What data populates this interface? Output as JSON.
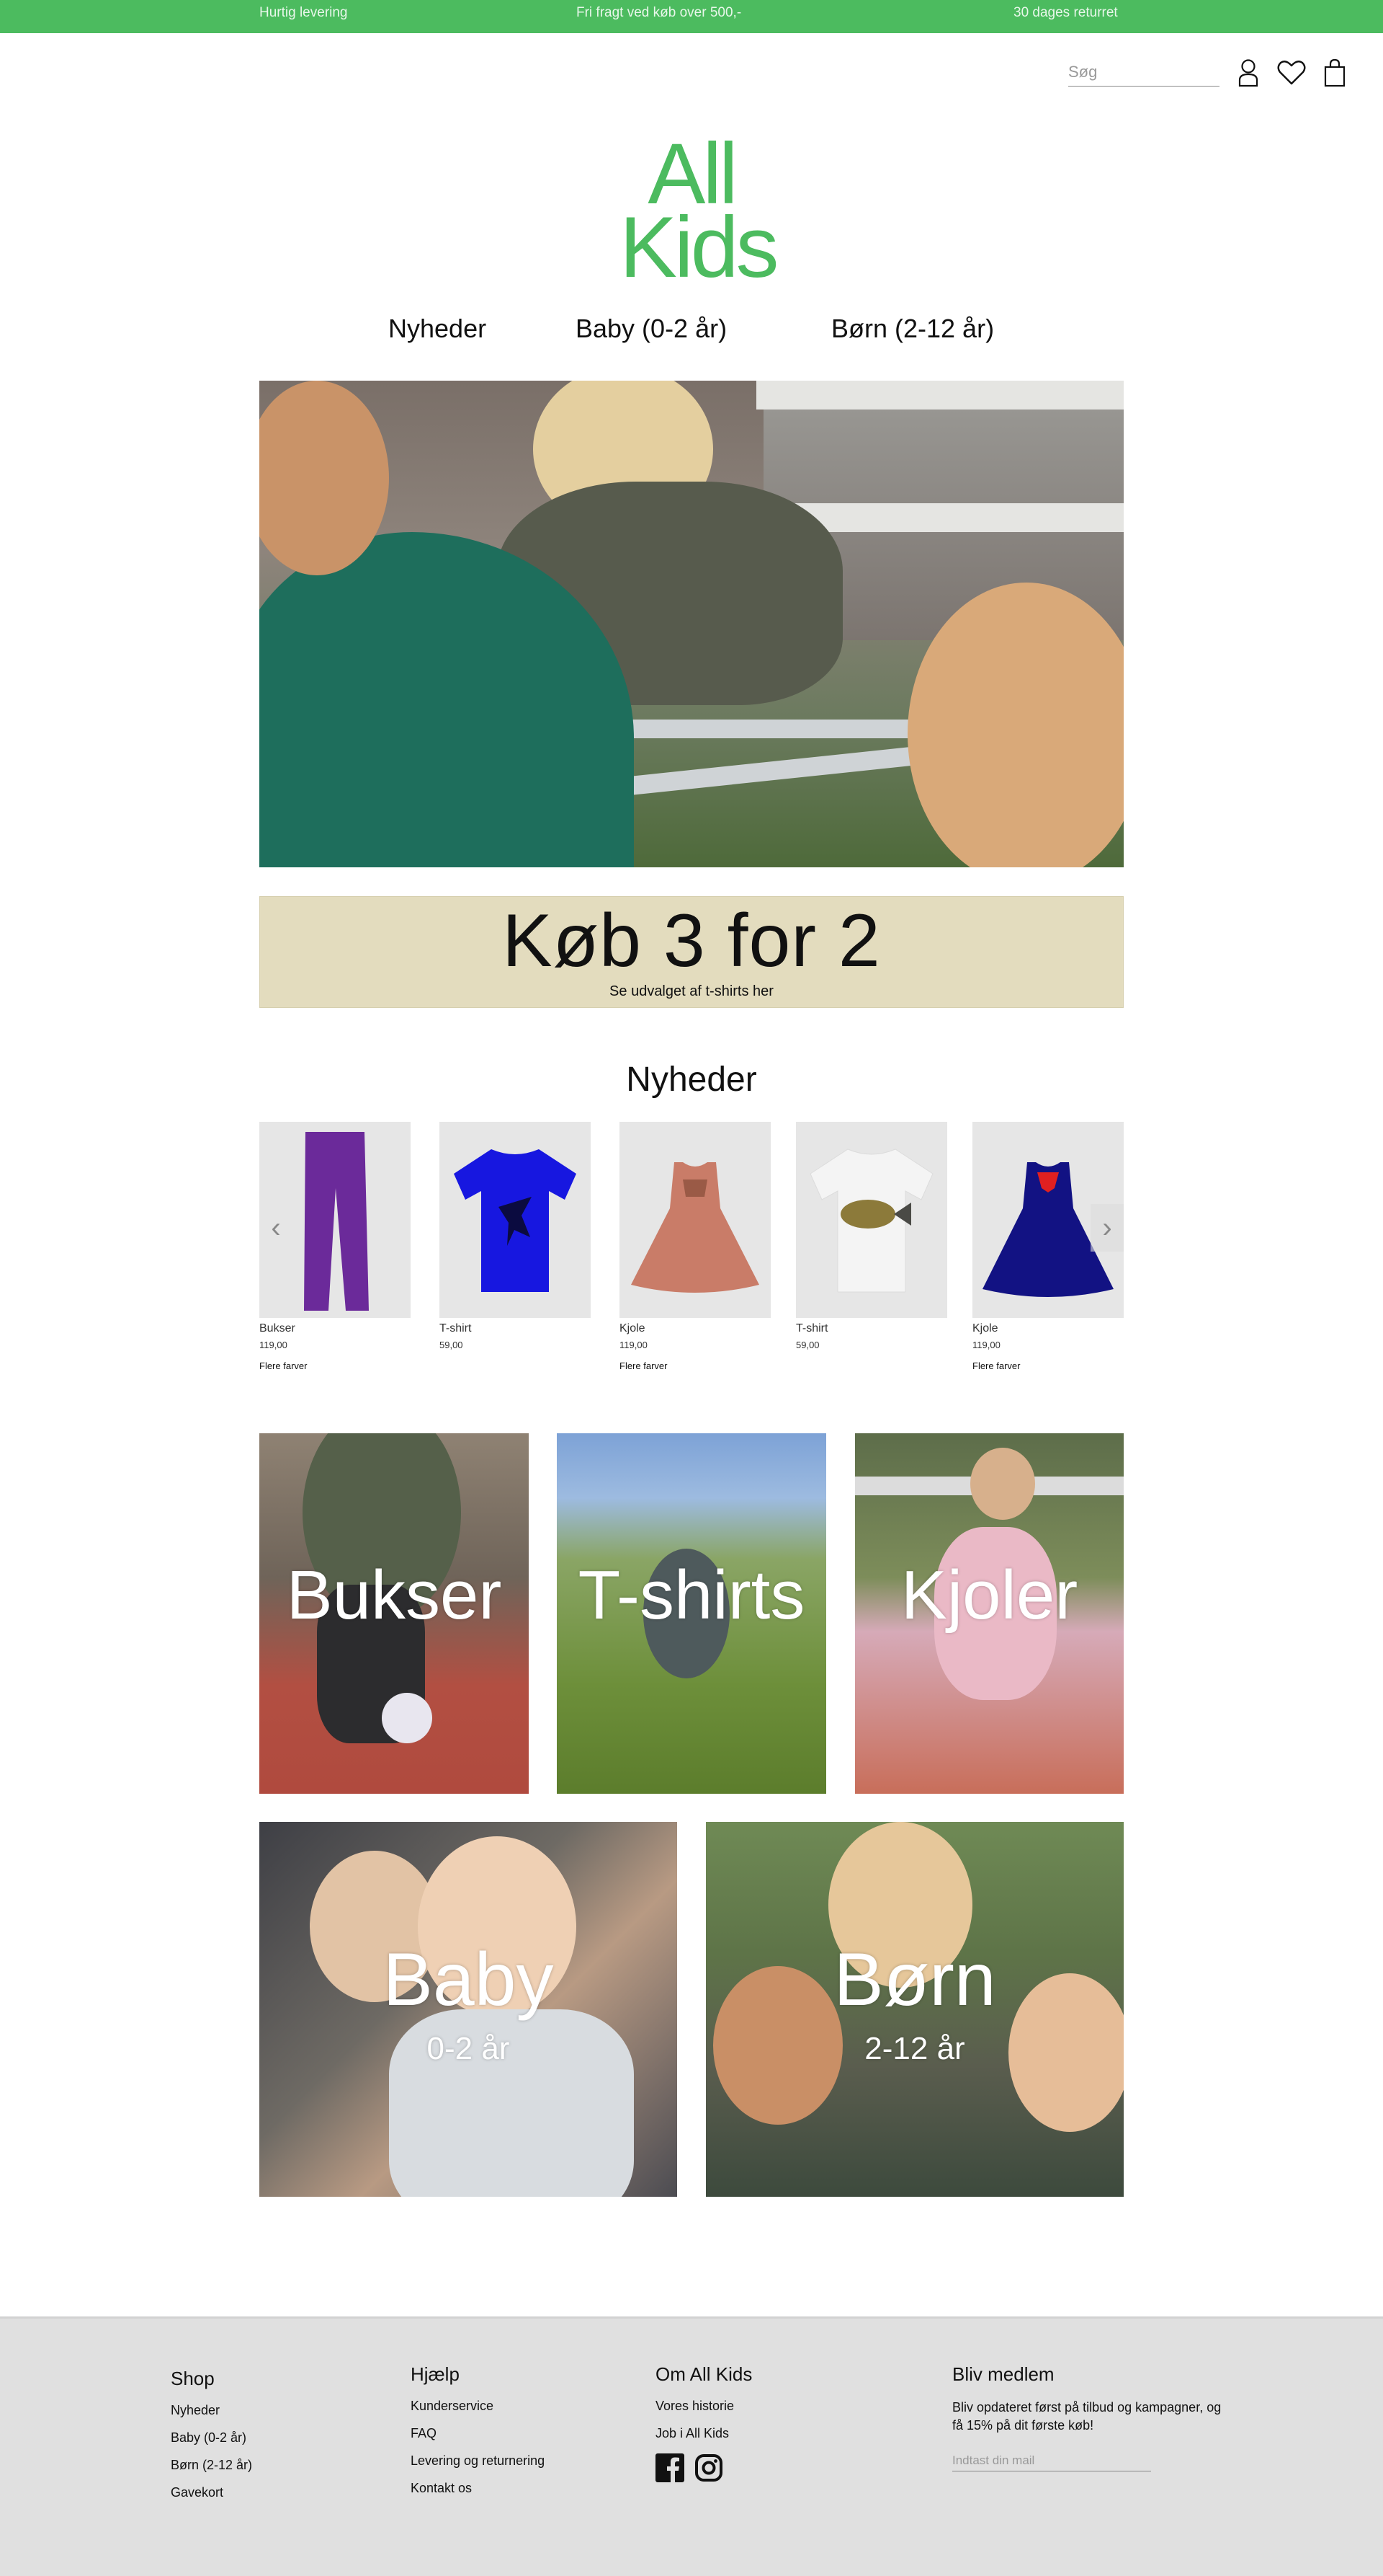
{
  "topbar": {
    "left": "Hurtig levering",
    "middle": "Fri fragt ved køb over 500,-",
    "right": "30 dages returret"
  },
  "header": {
    "search_placeholder": "Søg",
    "icons": [
      "user-icon",
      "heart-icon",
      "bag-icon"
    ]
  },
  "logo": {
    "line1": "All",
    "line2": "Kids",
    "color": "#4cbb5f"
  },
  "nav": {
    "items": [
      {
        "label": "Nyheder"
      },
      {
        "label": "Baby (0-2 år)"
      },
      {
        "label": "Børn (2-12 år)"
      }
    ]
  },
  "promo": {
    "title": "Køb 3 for 2",
    "subtitle": "Se udvalget af t-shirts her",
    "background": "#e3dcbe"
  },
  "new_section": {
    "title": "Nyheder"
  },
  "products": [
    {
      "name": "Bukser",
      "price": "119,00",
      "more": "Flere farver",
      "color": "#6b2a9a"
    },
    {
      "name": "T-shirt",
      "price": "59,00",
      "more": "",
      "color": "#1717e0"
    },
    {
      "name": "Kjole",
      "price": "119,00",
      "more": "Flere farver",
      "color": "#c97c68"
    },
    {
      "name": "T-shirt",
      "price": "59,00",
      "more": "",
      "color": "#f1f1f1"
    },
    {
      "name": "Kjole",
      "price": "119,00",
      "more": "Flere farver",
      "color": "#121283"
    }
  ],
  "carousel": {
    "prev": "‹",
    "next": "›"
  },
  "categories": {
    "bukser": "Bukser",
    "tshirts": "T-shirts",
    "kjoler": "Kjoler",
    "baby": {
      "title": "Baby",
      "sub": "0-2 år"
    },
    "born": {
      "title": "Børn",
      "sub": "2-12 år"
    }
  },
  "footer": {
    "shop": {
      "title": "Shop",
      "links": [
        "Nyheder",
        "Baby (0-2 år)",
        "Børn (2-12 år)",
        "Gavekort"
      ]
    },
    "help": {
      "title": "Hjælp",
      "links": [
        "Kunderservice",
        "FAQ",
        "Levering og returnering",
        "Kontakt os"
      ]
    },
    "about": {
      "title": "Om All Kids",
      "links": [
        "Vores historie",
        "Job i All Kids"
      ],
      "social": [
        "facebook-icon",
        "instagram-icon"
      ]
    },
    "club": {
      "title": "Bliv medlem",
      "text": "Bliv opdateret først på tilbud og kampagner, og få 15% på dit første køb!",
      "placeholder": "Indtast din mail"
    }
  }
}
